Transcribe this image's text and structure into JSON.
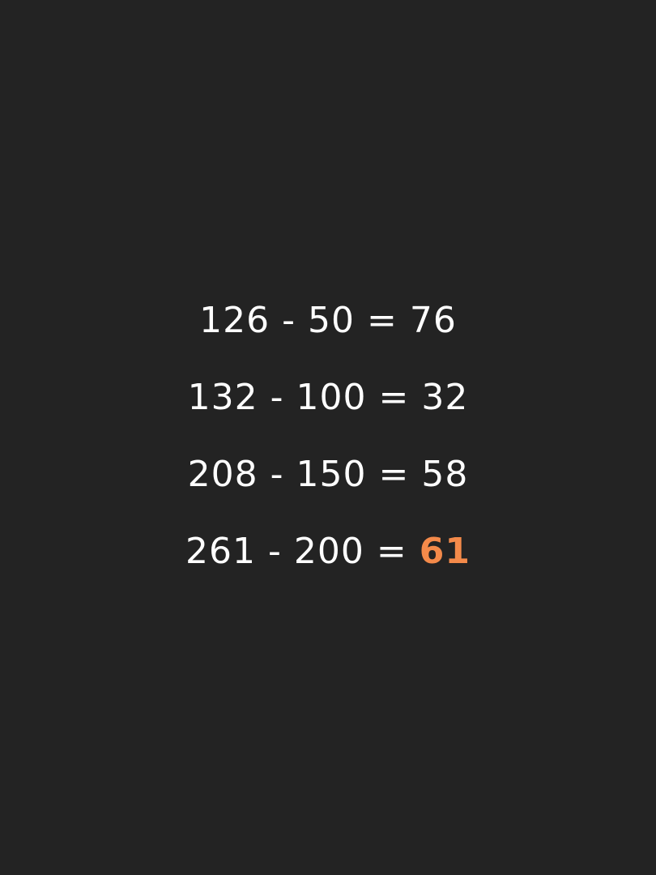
{
  "equations": [
    {
      "a": "126",
      "op": "-",
      "b": "50",
      "eq": "=",
      "result": "76"
    },
    {
      "a": "132",
      "op": "-",
      "b": "100",
      "eq": "=",
      "result": "32"
    },
    {
      "a": "208",
      "op": "-",
      "b": "150",
      "eq": "=",
      "result": "58"
    },
    {
      "a": "261",
      "op": "-",
      "b": "200",
      "eq": "=",
      "result": "61"
    }
  ],
  "colors": {
    "background": "#232323",
    "text": "#ffffff",
    "highlight": "#f48a4a"
  }
}
